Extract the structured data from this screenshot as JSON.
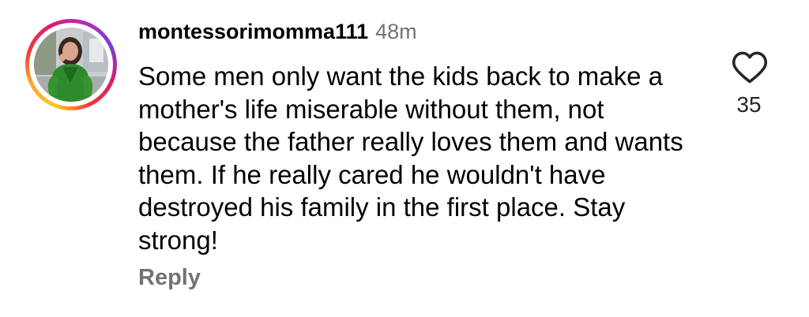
{
  "comment": {
    "username": "montessorimomma111",
    "time": "48m",
    "text": "Some men only want the kids back to make a mother's life miserable without them, not because the father really loves them and wants them. If he really cared he wouldn't have destroyed his family in the first place. Stay strong!",
    "reply_label": "Reply",
    "like_count": "35",
    "like_icon": "heart-outline-icon"
  },
  "colors": {
    "primary_text": "#000000",
    "secondary_text": "#737373",
    "story_ring_start": "#fdc91e",
    "story_ring_end": "#b02fb8"
  }
}
